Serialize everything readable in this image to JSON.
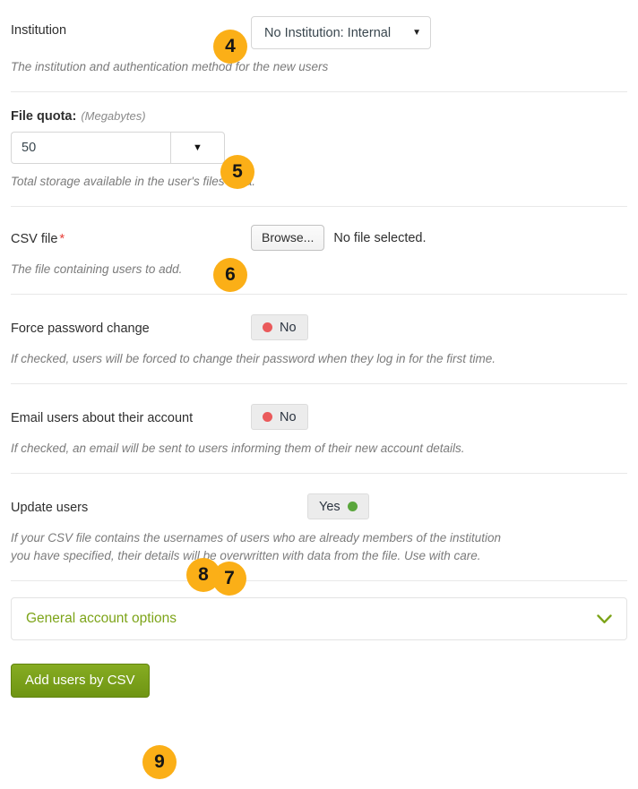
{
  "accent": {
    "badge_bg": "#fbaf17",
    "green": "#7da419",
    "red": "#ea5a5b",
    "switch_on_dot": "#5aa63c",
    "required_star": "#e8413a"
  },
  "fields": {
    "institution": {
      "label": "Institution",
      "badge": "4",
      "select_value": "No Institution: Internal",
      "caret_icon": "chevron-down-icon",
      "help": "The institution and authentication method for the new users"
    },
    "file_quota": {
      "label": "File quota:",
      "unit": "(Megabytes)",
      "badge": "5",
      "value": "50",
      "caret_icon": "chevron-down-icon",
      "help": "Total storage available in the user's files area."
    },
    "csv_file": {
      "label": "CSV file",
      "required_mark": "*",
      "badge": "6",
      "browse_label": "Browse...",
      "file_status": "No file selected.",
      "help": "The file containing users to add."
    },
    "force_password_change": {
      "label": "Force password change",
      "switch_value": "No",
      "switch_state": "off",
      "help": "If checked, users will be forced to change their password when they log in for the first time."
    },
    "email_users": {
      "label": "Email users about their account",
      "switch_value": "No",
      "switch_state": "off",
      "help": "If checked, an email will be sent to users informing them of their new account details."
    },
    "update_users": {
      "label": "Update users",
      "badge": "7",
      "switch_value": "Yes",
      "switch_state": "on",
      "help": "If your CSV file contains the usernames of users who are already members of the institution you have specified, their details will be overwritten with data from the file. Use with care."
    }
  },
  "accordion": {
    "title": "General account options",
    "badge": "8",
    "chevron_icon": "chevron-down-icon",
    "chevron_glyph": "⌄"
  },
  "submit": {
    "label": "Add users by CSV",
    "badge": "9"
  },
  "glyphs": {
    "caret_down": "▼"
  }
}
